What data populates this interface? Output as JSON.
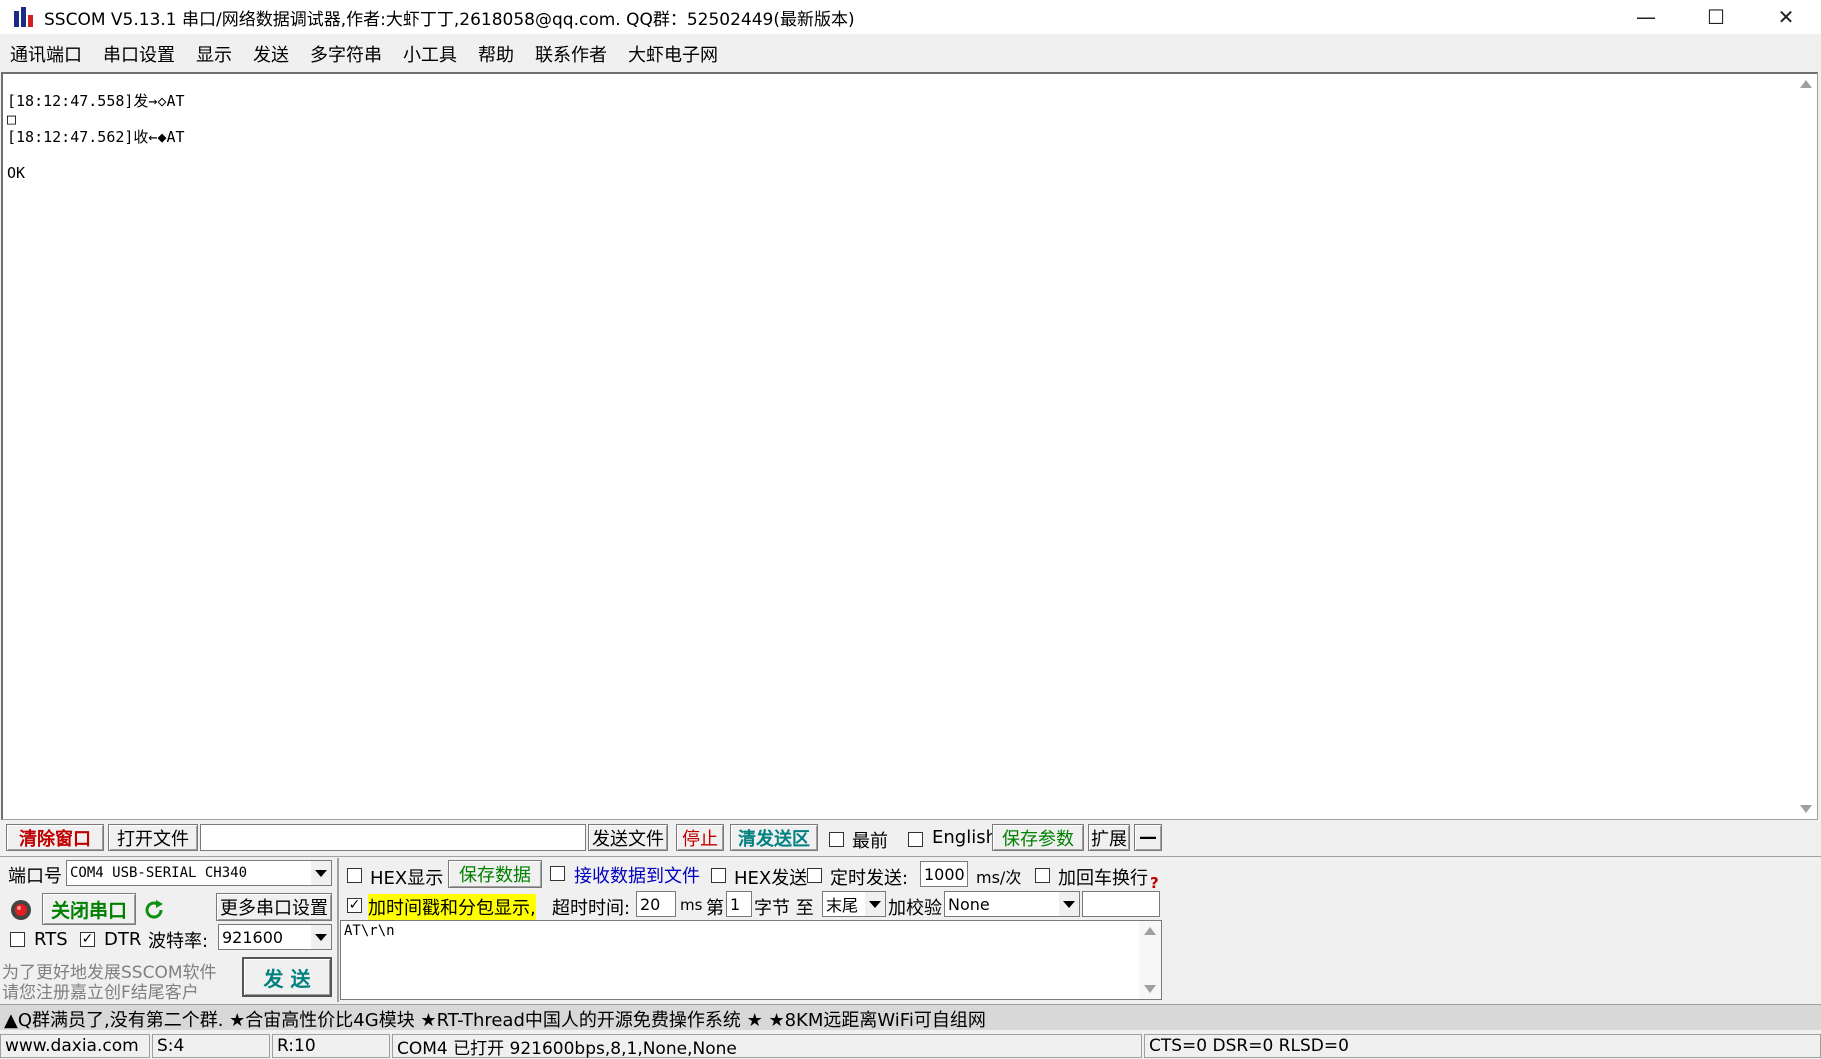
{
  "window": {
    "title": "SSCOM V5.13.1 串口/网络数据调试器,作者:大虾丁丁,2618058@qq.com. QQ群：52502449(最新版本)",
    "min_glyph": "—",
    "max_glyph": "☐",
    "close_glyph": "✕"
  },
  "menu": [
    "通讯端口",
    "串口设置",
    "显示",
    "发送",
    "多字符串",
    "小工具",
    "帮助",
    "联系作者",
    "大虾电子网"
  ],
  "receive": {
    "lines": "[18:12:47.558]发→◇AT\n□\n[18:12:47.562]收←◆AT\n\nOK"
  },
  "toolbar": {
    "clear_window": "清除窗口",
    "open_file": "打开文件",
    "file_path": "",
    "send_file": "发送文件",
    "stop": "停止",
    "clear_send": "清发送区",
    "topmost_label": "最前",
    "english_label": "English",
    "save_params": "保存参数",
    "expand": "扩展",
    "collapse": "—"
  },
  "port": {
    "label": "端口号",
    "value": "COM4 USB-SERIAL CH340",
    "close_port": "关闭串口",
    "more_settings": "更多串口设置",
    "rts_label": "RTS",
    "dtr_label": "DTR",
    "baud_label": "波特率:",
    "baud_value": "921600",
    "promo_line1": "为了更好地发展SSCOM软件",
    "promo_line2": "请您注册嘉立创F结尾客户",
    "send": "发 送"
  },
  "options": {
    "hex_display": "HEX显示",
    "save_data": "保存数据",
    "recv_to_file": "接收数据到文件",
    "hex_send": "HEX发送",
    "timed_send": "定时发送:",
    "interval": "1000",
    "interval_unit": "ms/次",
    "append_crlf": "加回车换行",
    "timestamp": "加时间戳和分包显示,",
    "timeout_label": "超时时间:",
    "timeout_value": "20",
    "timeout_unit": "ms",
    "byte_prefix": "第",
    "byte_from": "1",
    "byte_suffix": "字节 至",
    "byte_to": "末尾",
    "checksum_label": "加校验",
    "checksum_value": "None",
    "help": "?"
  },
  "send_text": "AT\\r\\n",
  "ticker": "▲Q群满员了,没有第二个群. ★合宙高性价比4G模块 ★RT-Thread中国人的开源免费操作系统 ★ ★8KM远距离WiFi可自组网",
  "status": {
    "website": "www.daxia.com",
    "sent": "S:4",
    "received": "R:10",
    "port_state": "COM4 已打开  921600bps,8,1,None,None",
    "lines": "CTS=0 DSR=0 RLSD=0"
  },
  "colors": {
    "clear_window": "#c00000",
    "close_port": "#008000",
    "save_green": "#008000",
    "stop": "#c00000",
    "clear_send": "#008080",
    "recv_to_file": "#0000c0",
    "highlight": "#ffff00"
  }
}
